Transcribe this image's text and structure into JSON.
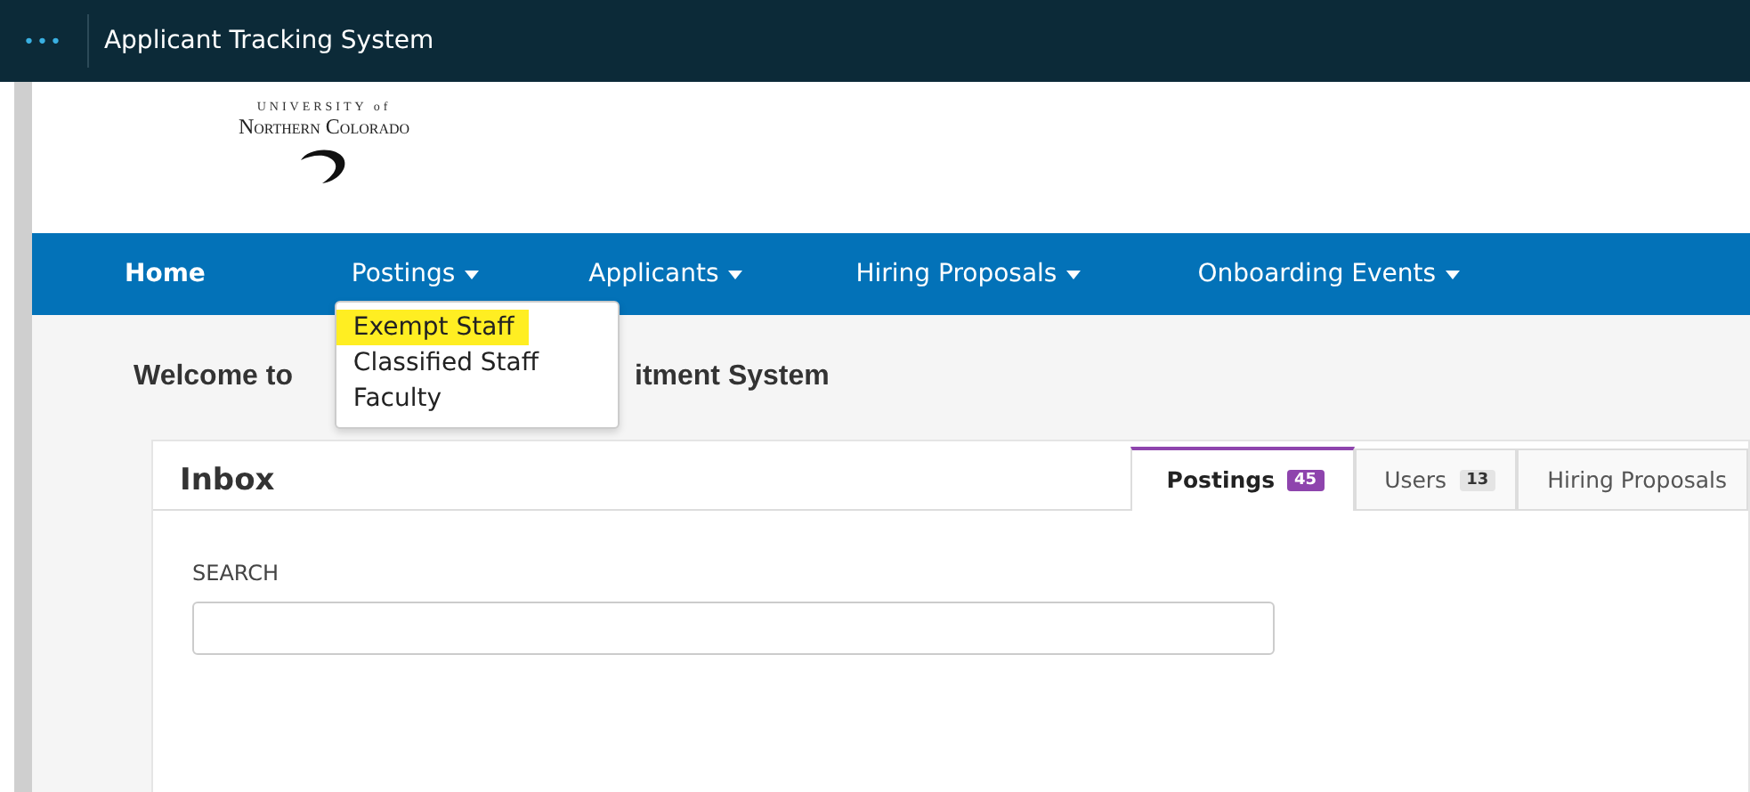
{
  "top_bar": {
    "menu_glyph": "•••",
    "title": "Applicant Tracking System"
  },
  "logo": {
    "line_1": "UNIVERSITY of",
    "line_2": "Northern Colorado"
  },
  "nav": [
    {
      "label": "Home",
      "dropdown": false
    },
    {
      "label": "Postings",
      "dropdown": true,
      "menu": [
        {
          "label": "Exempt Staff",
          "highlighted": true
        },
        {
          "label": "Classified Staff",
          "highlighted": false
        },
        {
          "label": "Faculty",
          "highlighted": false
        }
      ]
    },
    {
      "label": "Applicants",
      "dropdown": true
    },
    {
      "label": "Hiring Proposals",
      "dropdown": true
    },
    {
      "label": "Onboarding Events",
      "dropdown": true
    }
  ],
  "welcome": {
    "visible_start": "Welcome to",
    "visible_end": "itment System"
  },
  "inbox": {
    "title": "Inbox",
    "tabs": [
      {
        "label": "Postings",
        "count": "45",
        "color": "#8e44ad",
        "selected": true
      },
      {
        "label": "Users",
        "count": "13",
        "color": "#e4e4e4",
        "selected": false
      },
      {
        "label": "Hiring Proposals",
        "selected": false
      }
    ],
    "search": {
      "label": "SEARCH"
    }
  }
}
